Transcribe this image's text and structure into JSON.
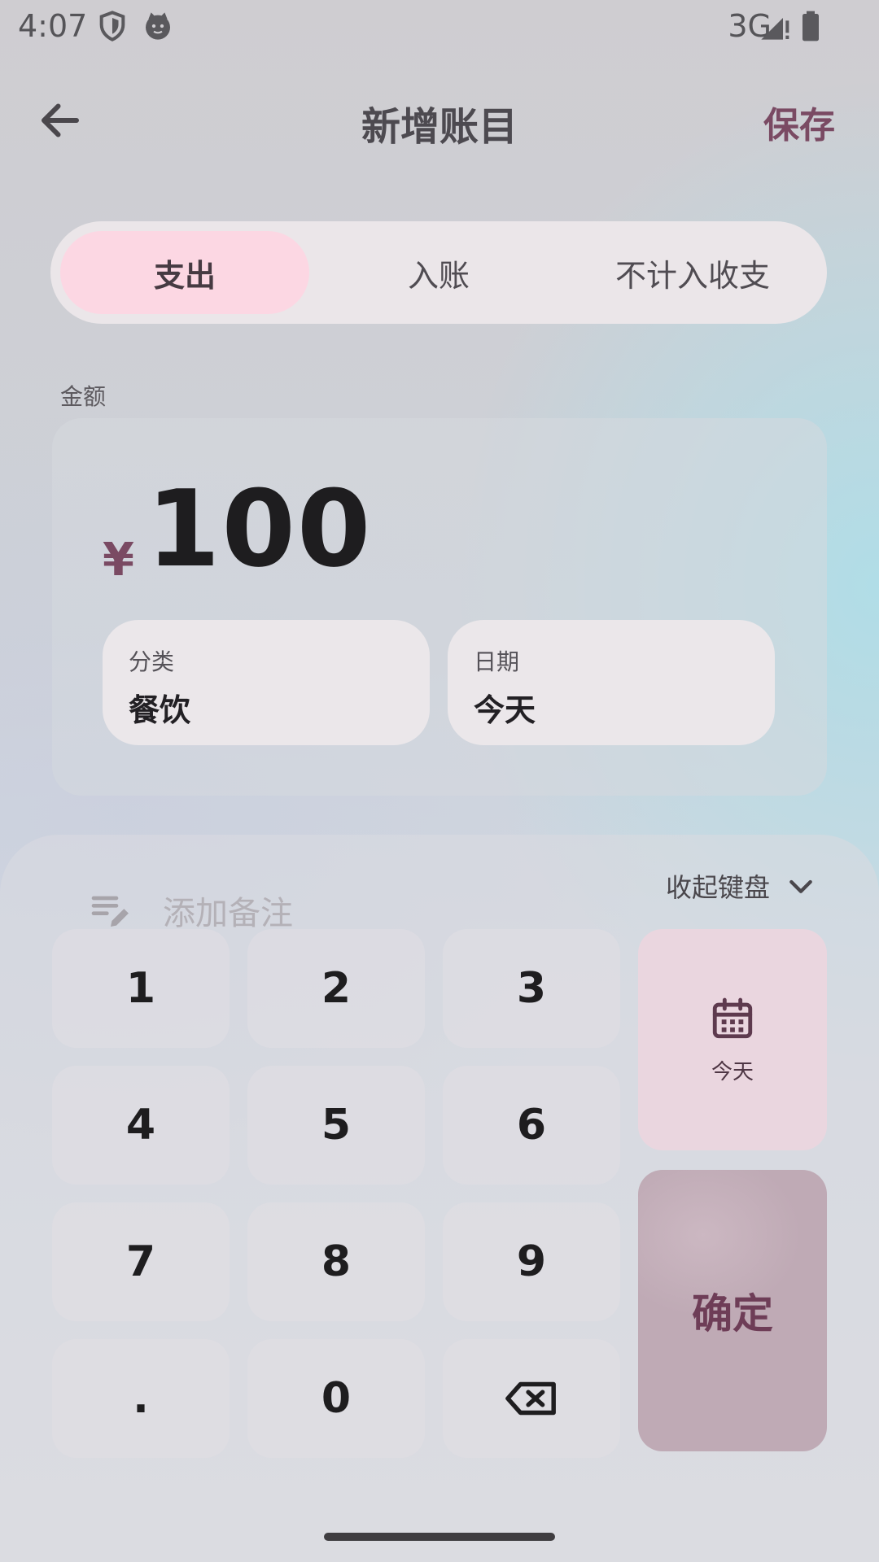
{
  "status_bar": {
    "time": "4:07",
    "network": "3G"
  },
  "header": {
    "title": "新增账目",
    "save_label": "保存"
  },
  "tabs": [
    {
      "label": "支出",
      "active": true
    },
    {
      "label": "入账",
      "active": false
    },
    {
      "label": "不计入收支",
      "active": false
    }
  ],
  "amount": {
    "label": "金额",
    "currency": "¥",
    "value": "100"
  },
  "category": {
    "label": "分类",
    "value": "餐饮"
  },
  "date": {
    "label": "日期",
    "value": "今天"
  },
  "keyboard": {
    "collapse_label": "收起键盘",
    "note_placeholder": "添加备注",
    "keys": [
      "1",
      "2",
      "3",
      "4",
      "5",
      "6",
      "7",
      "8",
      "9",
      ".",
      "0"
    ],
    "today_label": "今天",
    "confirm_label": "确定"
  },
  "colors": {
    "accent": "#7a4a63",
    "active_tab": "#fcd7e3",
    "confirm": "#bfaab5",
    "today_key": "#ead6df"
  },
  "icons": [
    "shield-icon",
    "cat-face-icon",
    "signal-icon",
    "battery-icon",
    "back-arrow-icon",
    "note-edit-icon",
    "chevron-down-icon",
    "calendar-icon",
    "backspace-icon"
  ]
}
